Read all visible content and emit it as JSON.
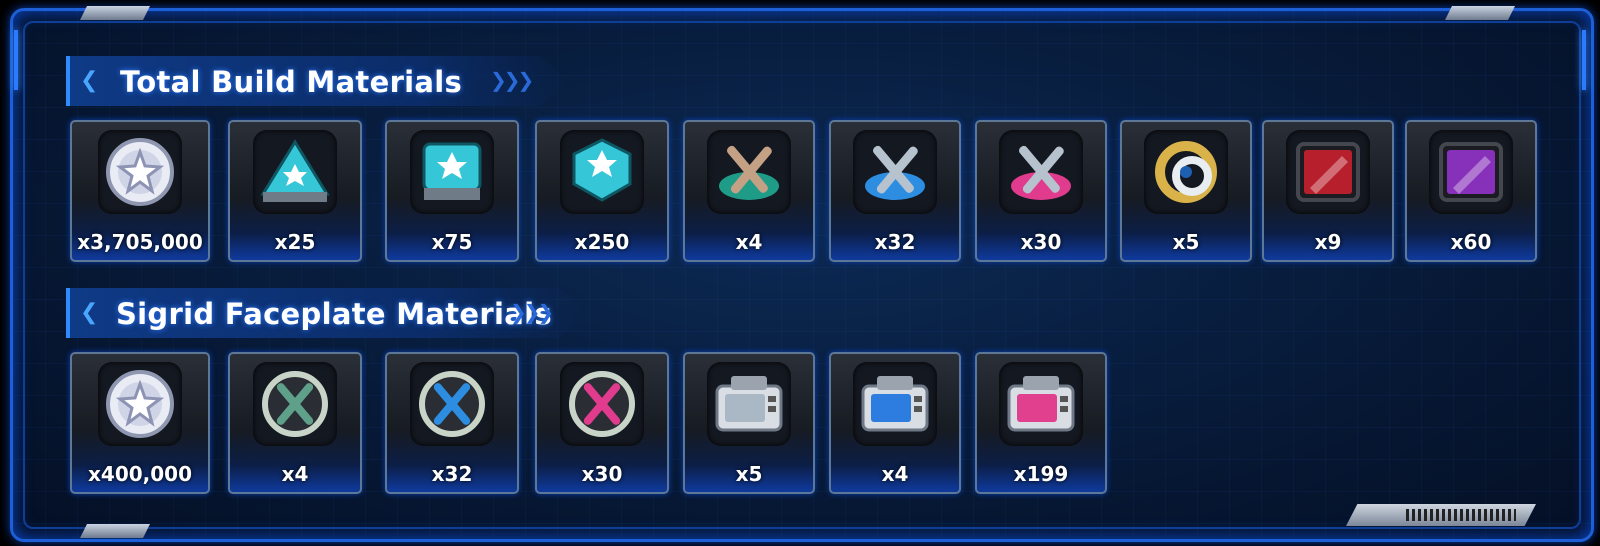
{
  "sections": [
    {
      "title": "Total Build Materials",
      "items": [
        {
          "qty": "x3,705,000",
          "icon": "silver-coin-icon",
          "color": "#c9cde6"
        },
        {
          "qty": "x25",
          "icon": "blue-triangle-cube-icon",
          "color": "#35c6d8"
        },
        {
          "qty": "x75",
          "icon": "blue-square-cube-icon",
          "color": "#35c6d8"
        },
        {
          "qty": "x250",
          "icon": "blue-hexagon-cube-icon",
          "color": "#35c6d8"
        },
        {
          "qty": "x4",
          "icon": "green-crossed-bones-icon",
          "color": "#1f9c88"
        },
        {
          "qty": "x32",
          "icon": "blue-crossed-bones-icon",
          "color": "#2d8de0"
        },
        {
          "qty": "x30",
          "icon": "pink-crossed-bones-icon",
          "color": "#e03b8c"
        },
        {
          "qty": "x5",
          "icon": "gold-ring-icon",
          "color": "#d9b24a"
        },
        {
          "qty": "x9",
          "icon": "red-crystal-chip-icon",
          "color": "#d4202e"
        },
        {
          "qty": "x60",
          "icon": "purple-crystal-chip-icon",
          "color": "#9a35d6"
        }
      ]
    },
    {
      "title": "Sigrid Faceplate Materials",
      "items": [
        {
          "qty": "x400,000",
          "icon": "silver-coin-icon",
          "color": "#c9cde6"
        },
        {
          "qty": "x4",
          "icon": "green-bones-disc-icon",
          "color": "#5fa08a"
        },
        {
          "qty": "x32",
          "icon": "blue-bones-disc-icon",
          "color": "#2d8de0"
        },
        {
          "qty": "x30",
          "icon": "pink-bones-disc-icon",
          "color": "#e03b8c"
        },
        {
          "qty": "x5",
          "icon": "silver-faceplate-icon",
          "color": "#a9b8c4"
        },
        {
          "qty": "x4",
          "icon": "blue-faceplate-icon",
          "color": "#2d7de0"
        },
        {
          "qty": "x199",
          "icon": "pink-faceplate-icon",
          "color": "#e0408e"
        }
      ]
    }
  ]
}
